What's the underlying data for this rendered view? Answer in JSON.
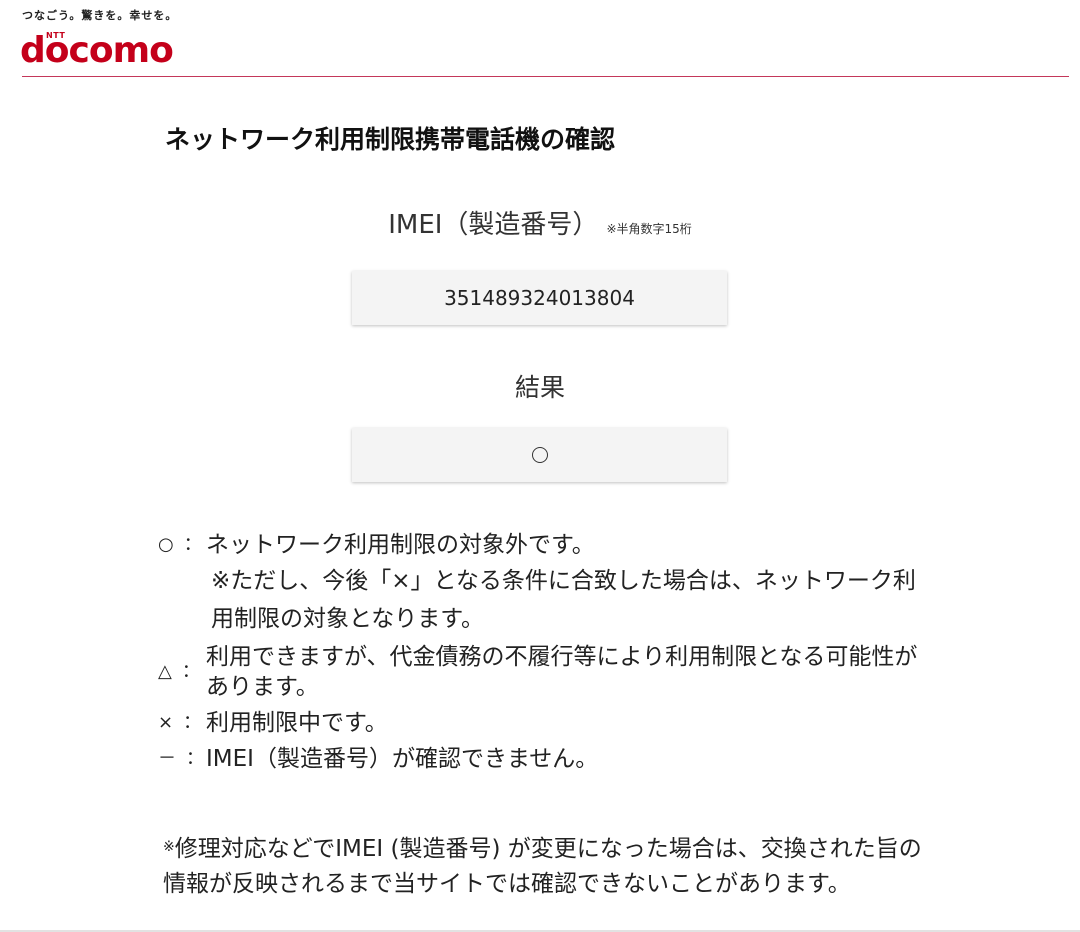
{
  "header": {
    "tagline": "つなごう。驚きを。幸せを。",
    "logo_small": "NTT",
    "logo_word": "docomo",
    "brand_color": "#c4001a"
  },
  "main": {
    "title": "ネットワーク利用制限携帯電話機の確認",
    "imei_label": "IMEI（製造番号）",
    "imei_note": "※半角数字15桁",
    "imei_value": "351489324013804",
    "result_label": "結果",
    "result_icon": "circle-mark-icon"
  },
  "legend": {
    "rows": [
      {
        "symbol": "○",
        "colon": "：",
        "text": "ネットワーク利用制限の対象外です。",
        "sub": "※ただし、今後「×」となる条件に合致した場合は、ネットワーク利用制限の対象となります。"
      },
      {
        "symbol": "△",
        "colon": "：",
        "text": "利用できますが、代金債務の不履行等により利用制限となる可能性があります。"
      },
      {
        "symbol": "×",
        "colon": "：",
        "text": "利用制限中です。"
      },
      {
        "symbol": "－",
        "colon": "：",
        "text": "IMEI（製造番号）が確認できません。"
      }
    ]
  },
  "footnote": {
    "mark": "※",
    "text": "修理対応などでIMEI (製造番号) が変更になった場合は、交換された旨の情報が反映されるまで当サイトでは確認できないことがあります。"
  }
}
